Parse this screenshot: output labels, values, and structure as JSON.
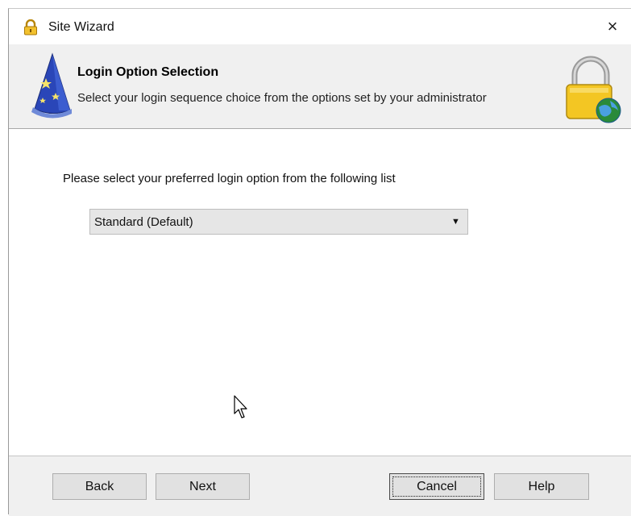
{
  "window": {
    "title": "Site Wizard",
    "title_icon": "padlock-icon",
    "close_label": "×"
  },
  "header": {
    "title": "Login Option Selection",
    "subtitle": "Select your login sequence choice from the options set by your administrator",
    "left_icon": "wizard-hat-icon",
    "right_icon": "padlock-globe-icon"
  },
  "body": {
    "prompt": "Please select your preferred  login option from the following list",
    "login_option": {
      "selected": "Standard  (Default)"
    }
  },
  "buttons": {
    "back": "Back",
    "next": "Next",
    "cancel": "Cancel",
    "help": "Help"
  },
  "colors": {
    "header_band": "#f0f0f0",
    "footer_band": "#f0f0f0",
    "button_face": "#e1e1e1",
    "select_face": "#e6e6e6"
  }
}
